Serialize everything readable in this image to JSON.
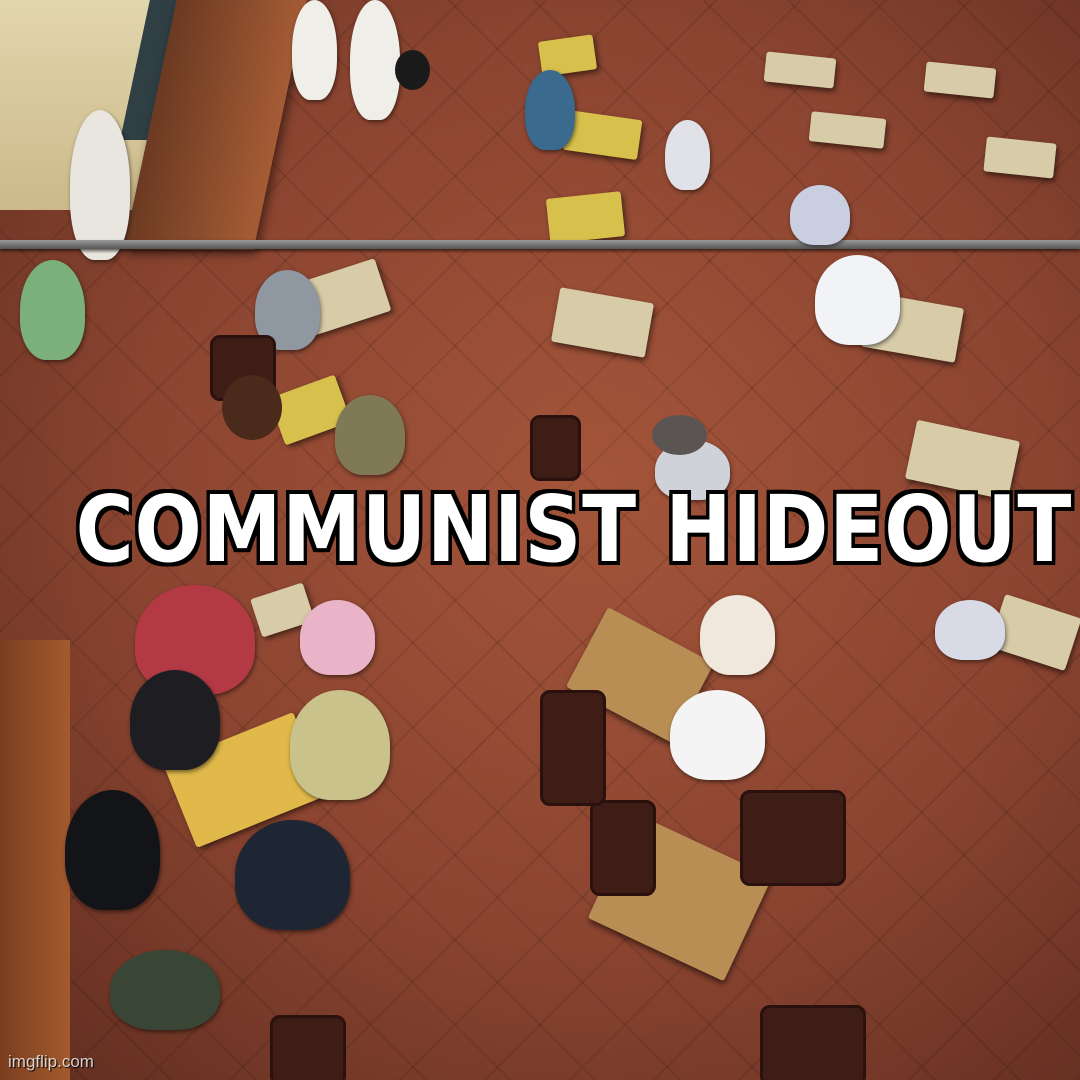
{
  "meme": {
    "caption": "COMMUNIST HIDEOUT",
    "watermark": "imgflip.com"
  },
  "colors": {
    "floor": "#8a4430",
    "caption_text": "#ffffff",
    "caption_outline": "#000000"
  }
}
